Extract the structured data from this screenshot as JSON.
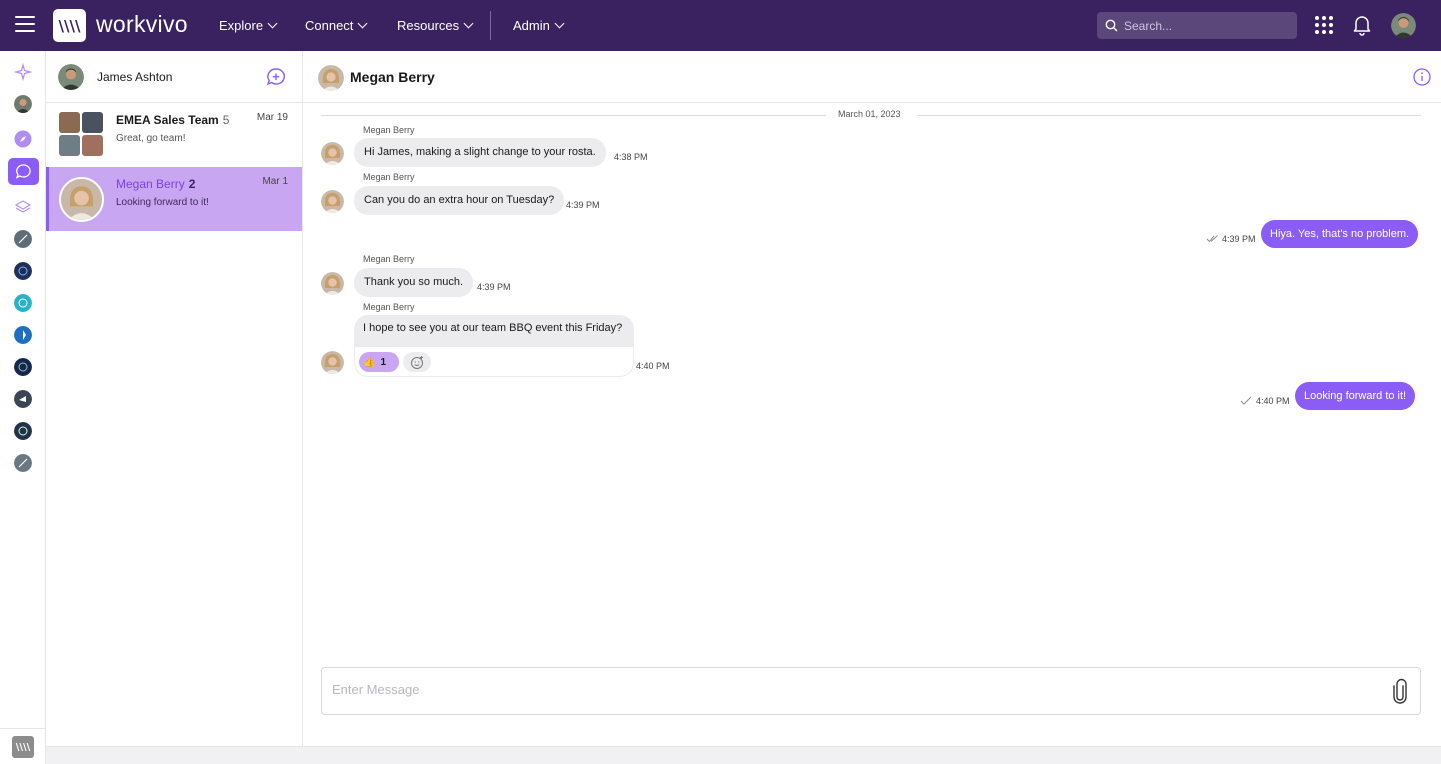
{
  "brand": {
    "logo_mark": "\\\\\\\\",
    "name": "workvivo",
    "color": "#3a2160",
    "accent": "#8b5cf6"
  },
  "topnav": {
    "items": [
      {
        "label": "Explore"
      },
      {
        "label": "Connect"
      },
      {
        "label": "Resources"
      },
      {
        "label": "Admin"
      }
    ],
    "search_placeholder": "Search..."
  },
  "rail": {
    "bottom_logo": "\\\\\\\\"
  },
  "conversations": {
    "me": {
      "name": "James Ashton"
    },
    "items": [
      {
        "title": "EMEA Sales Team",
        "count": "5",
        "date": "Mar 19",
        "preview": "Great, go team!",
        "active": false
      },
      {
        "title": "Megan Berry",
        "count": "2",
        "date": "Mar 1",
        "preview": "Looking forward to it!",
        "active": true
      }
    ]
  },
  "chat": {
    "contact_name": "Megan Berry",
    "date_separator": "March 01, 2023",
    "messages": [
      {
        "sender": "Megan Berry",
        "text": "Hi James, making a slight change to your rosta.",
        "time": "4:38 PM",
        "direction": "in"
      },
      {
        "sender": "Megan Berry",
        "text": "Can you do an extra hour on Tuesday?",
        "time": "4:39 PM",
        "direction": "in"
      },
      {
        "text": "Hiya. Yes, that's no problem.",
        "time": "4:39 PM",
        "direction": "out"
      },
      {
        "sender": "Megan Berry",
        "text": "Thank you so much.",
        "time": "4:39 PM",
        "direction": "in"
      },
      {
        "sender": "Megan Berry",
        "text": "I hope to see you at our team BBQ event this Friday?",
        "time": "4:40 PM",
        "direction": "in",
        "reaction": {
          "emoji": "👍",
          "count": "1"
        }
      },
      {
        "text": "Looking forward to it!",
        "time": "4:40 PM",
        "direction": "out"
      }
    ],
    "composer_placeholder": "Enter Message"
  }
}
